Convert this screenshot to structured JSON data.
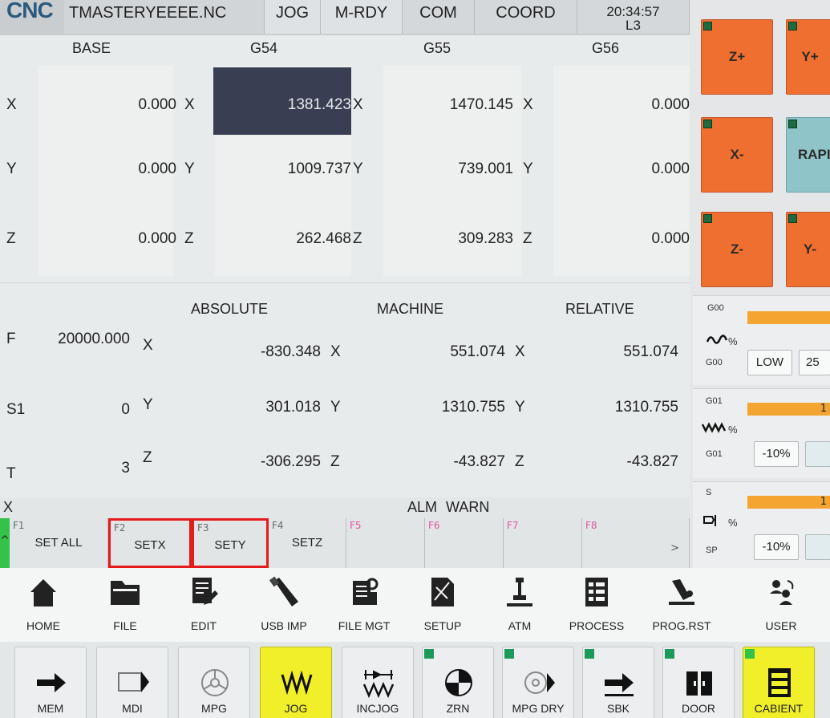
{
  "header": {
    "logo": "CNC",
    "filename": "TMASTERYEEEE.NC",
    "mode": "JOG",
    "status": "M-RDY",
    "com": "COM",
    "coord": "COORD",
    "time": "20:34:57",
    "line": "L3"
  },
  "offsets": {
    "headers": [
      "BASE",
      "G54",
      "G55",
      "G56"
    ],
    "rows": [
      {
        "axis": "X",
        "values": [
          "0.000",
          "1381.423",
          "1470.145",
          "0.000"
        ]
      },
      {
        "axis": "Y",
        "values": [
          "0.000",
          "1009.737",
          "739.001",
          "0.000"
        ]
      },
      {
        "axis": "Z",
        "values": [
          "0.000",
          "262.468",
          "309.283",
          "0.000"
        ]
      }
    ]
  },
  "positions": {
    "headers": [
      "ABSOLUTE",
      "MACHINE",
      "RELATIVE"
    ],
    "rows": [
      {
        "label": "F",
        "label_value": "20000.000",
        "axis": "X",
        "values": [
          "-830.348",
          "551.074",
          "551.074"
        ]
      },
      {
        "label": "S1",
        "label_value": "0",
        "axis": "Y",
        "values": [
          "301.018",
          "1310.755",
          "1310.755"
        ]
      },
      {
        "label": "T",
        "label_value": "3",
        "axis": "Z",
        "values": [
          "-306.295",
          "-43.827",
          "-43.827"
        ]
      }
    ]
  },
  "alarm": {
    "input_label": "X",
    "alm": "ALM",
    "warn": "WARN"
  },
  "fkeys": {
    "up": "^",
    "more": ">",
    "items": [
      {
        "num": "F1",
        "label": "SET ALL"
      },
      {
        "num": "F2",
        "label": "SETX"
      },
      {
        "num": "F3",
        "label": "SETY"
      },
      {
        "num": "F4",
        "label": "SETZ"
      },
      {
        "num": "F5",
        "label": ""
      },
      {
        "num": "F6",
        "label": ""
      },
      {
        "num": "F7",
        "label": ""
      },
      {
        "num": "F8",
        "label": ""
      }
    ]
  },
  "menu": {
    "items": [
      {
        "label": "HOME",
        "icon": "home-icon"
      },
      {
        "label": "FILE",
        "icon": "folder-icon"
      },
      {
        "label": "EDIT",
        "icon": "edit-icon"
      },
      {
        "label": "USB IMP",
        "icon": "usb-icon"
      },
      {
        "label": "FILE MGT",
        "icon": "file-manager-icon"
      },
      {
        "label": "SETUP",
        "icon": "setup-icon"
      },
      {
        "label": "ATM",
        "icon": "atm-icon"
      },
      {
        "label": "PROCESS",
        "icon": "process-icon"
      },
      {
        "label": "PROG.RST",
        "icon": "program-reset-icon"
      },
      {
        "label": "USER",
        "icon": "user-icon"
      }
    ]
  },
  "modes": {
    "items": [
      {
        "label": "MEM",
        "icon": "arrow-right-icon"
      },
      {
        "label": "MDI",
        "icon": "hand-arrow-icon"
      },
      {
        "label": "MPG",
        "icon": "handwheel-icon"
      },
      {
        "label": "JOG",
        "icon": "jog-wave-icon"
      },
      {
        "label": "INCJOG",
        "icon": "incjog-icon"
      },
      {
        "label": "ZRN",
        "icon": "zero-return-icon"
      },
      {
        "label": "MPG DRY",
        "icon": "handwheel-arrow-icon"
      },
      {
        "label": "SBK",
        "icon": "single-block-icon"
      },
      {
        "label": "DOOR",
        "icon": "door-icon"
      },
      {
        "label": "CABIENT",
        "icon": "cabinet-icon"
      }
    ]
  },
  "jog": {
    "buttons": [
      "Z+",
      "Y+",
      "X-",
      "RAPI",
      "Z-",
      "Y-"
    ]
  },
  "overrides": {
    "g00_top": "G00",
    "g00_bottom": "G00",
    "g00_low": "LOW",
    "g00_val": "25",
    "g01_top": "G01",
    "g01_bottom": "G01",
    "g01_minus": "-10%",
    "g01_right": "1",
    "s_top": "S",
    "sp": "SP",
    "s_minus": "-10%",
    "s_right": "1",
    "percent": "%"
  },
  "colors": {
    "jog_orange": "#ef6f31",
    "rapid_teal": "#8fc4c9",
    "active_mode": "#f0ef2a",
    "selected_cell": "#3a3e52",
    "highlight_red": "#e51a1a",
    "led_green": "#1d9a5b",
    "override_bar": "#f3a431"
  }
}
